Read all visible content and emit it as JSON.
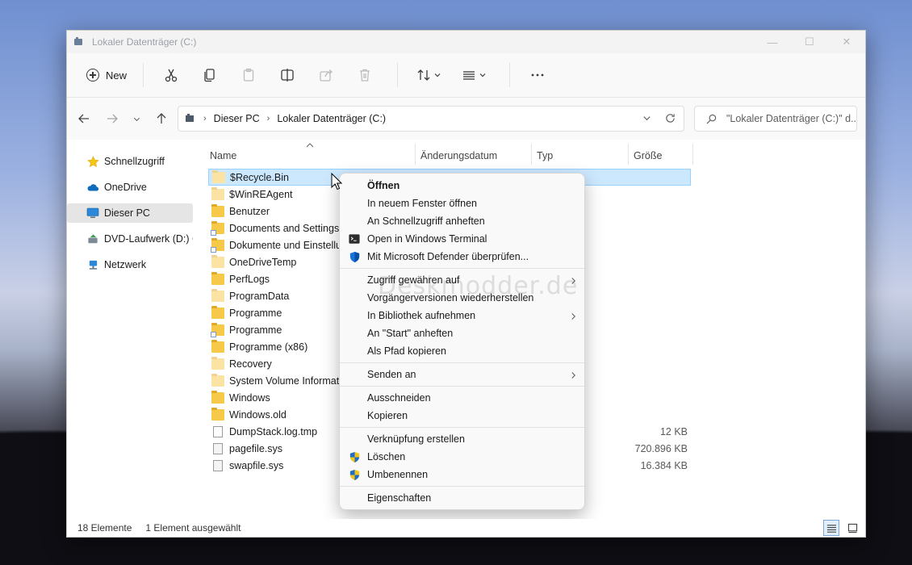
{
  "window": {
    "title": "Lokaler Datenträger (C:)",
    "controls": {
      "minimize": "—",
      "maximize": "☐",
      "close": "✕"
    }
  },
  "toolbar": {
    "new_label": "New",
    "icons": [
      "cut-icon",
      "copy-icon",
      "paste-icon",
      "rename-icon",
      "share-icon",
      "delete-icon",
      "sort-icon",
      "view-icon",
      "more-icon"
    ]
  },
  "address": {
    "crumbs": [
      "Dieser PC",
      "Lokaler Datenträger (C:)"
    ],
    "search_placeholder": "\"Lokaler Datenträger (C:)\" d..."
  },
  "sidebar": {
    "items": [
      {
        "label": "Schnellzugriff",
        "icon": "star-icon"
      },
      {
        "label": "OneDrive",
        "icon": "cloud-icon"
      },
      {
        "label": "Dieser PC",
        "icon": "monitor-icon",
        "selected": true
      },
      {
        "label": "DVD-Laufwerk (D:) CC",
        "icon": "dvd-drive-icon"
      },
      {
        "label": "Netzwerk",
        "icon": "network-icon"
      }
    ]
  },
  "columns": {
    "name": "Name",
    "date": "Änderungsdatum",
    "type": "Typ",
    "size": "Größe"
  },
  "files": [
    {
      "name": "$Recycle.Bin",
      "kind": "folder-hidden",
      "size": "",
      "selected": true
    },
    {
      "name": "$WinREAgent",
      "kind": "folder-hidden",
      "size": ""
    },
    {
      "name": "Benutzer",
      "kind": "folder",
      "size": ""
    },
    {
      "name": "Documents and Settings",
      "kind": "folder-shortcut",
      "size": ""
    },
    {
      "name": "Dokumente und Einstellungen",
      "kind": "folder-shortcut",
      "size": ""
    },
    {
      "name": "OneDriveTemp",
      "kind": "folder-hidden",
      "size": ""
    },
    {
      "name": "PerfLogs",
      "kind": "folder",
      "size": ""
    },
    {
      "name": "ProgramData",
      "kind": "folder-hidden",
      "size": ""
    },
    {
      "name": "Programme",
      "kind": "folder",
      "size": ""
    },
    {
      "name": "Programme",
      "kind": "folder-shortcut",
      "size": ""
    },
    {
      "name": "Programme (x86)",
      "kind": "folder",
      "size": ""
    },
    {
      "name": "Recovery",
      "kind": "folder-hidden",
      "size": ""
    },
    {
      "name": "System Volume Information",
      "kind": "folder-hidden",
      "size": ""
    },
    {
      "name": "Windows",
      "kind": "folder",
      "size": ""
    },
    {
      "name": "Windows.old",
      "kind": "folder",
      "size": ""
    },
    {
      "name": "DumpStack.log.tmp",
      "kind": "file",
      "size": "12 KB"
    },
    {
      "name": "pagefile.sys",
      "kind": "sysfile",
      "size": "720.896 KB"
    },
    {
      "name": "swapfile.sys",
      "kind": "sysfile",
      "size": "16.384 KB"
    }
  ],
  "status": {
    "count": "18 Elemente",
    "selection": "1 Element ausgewählt"
  },
  "context_menu": {
    "groups": [
      [
        {
          "label": "Öffnen",
          "bold": true
        },
        {
          "label": "In neuem Fenster öffnen"
        },
        {
          "label": "An Schnellzugriff anheften"
        },
        {
          "label": "Open in Windows Terminal",
          "icon": "terminal-icon"
        },
        {
          "label": "Mit Microsoft Defender überprüfen...",
          "icon": "defender-shield-icon"
        }
      ],
      [
        {
          "label": "Zugriff gewähren auf",
          "submenu": true
        },
        {
          "label": "Vorgängerversionen wiederherstellen"
        },
        {
          "label": "In Bibliothek aufnehmen",
          "submenu": true
        },
        {
          "label": "An \"Start\" anheften"
        },
        {
          "label": "Als Pfad kopieren"
        }
      ],
      [
        {
          "label": "Senden an",
          "submenu": true
        }
      ],
      [
        {
          "label": "Ausschneiden"
        },
        {
          "label": "Kopieren"
        }
      ],
      [
        {
          "label": "Verknüpfung erstellen"
        },
        {
          "label": "Löschen",
          "icon": "uac-shield-icon"
        },
        {
          "label": "Umbenennen",
          "icon": "uac-shield-icon"
        }
      ],
      [
        {
          "label": "Eigenschaften"
        }
      ]
    ]
  },
  "watermark": "Deskmodder.de",
  "colors": {
    "selection_bg": "#cce8ff",
    "selection_border": "#99d1ff",
    "folder": "#f7c948",
    "accent": "#0067c0"
  }
}
